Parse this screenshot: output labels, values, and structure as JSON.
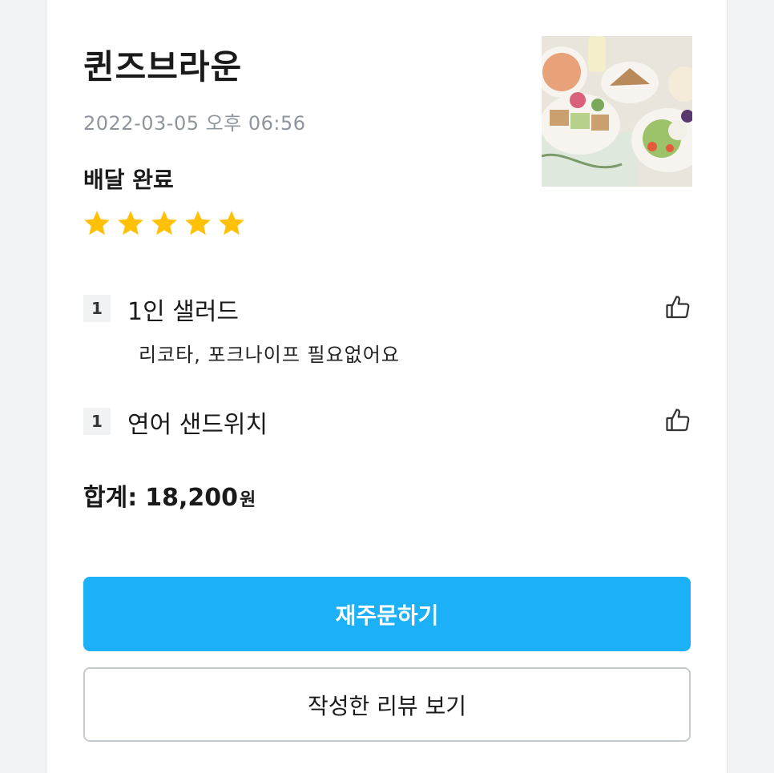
{
  "order": {
    "store_name": "퀸즈브라운",
    "datetime": "2022-03-05 오후 06:56",
    "status": "배달 완료",
    "rating": 5,
    "star_color": "#ffc107",
    "items": [
      {
        "qty": "1",
        "name": "1인 샐러드",
        "option": "리코타, 포크나이프 필요없어요"
      },
      {
        "qty": "1",
        "name": "연어 샌드위치"
      }
    ],
    "total_label": "합계:",
    "total_amount": "18,200",
    "currency": "원"
  },
  "actions": {
    "reorder_label": "재주문하기",
    "view_review_label": "작성한 리뷰 보기",
    "primary_color": "#1cb0f6"
  },
  "icons": {
    "like": "thumbs-up-icon",
    "star": "star-icon"
  }
}
